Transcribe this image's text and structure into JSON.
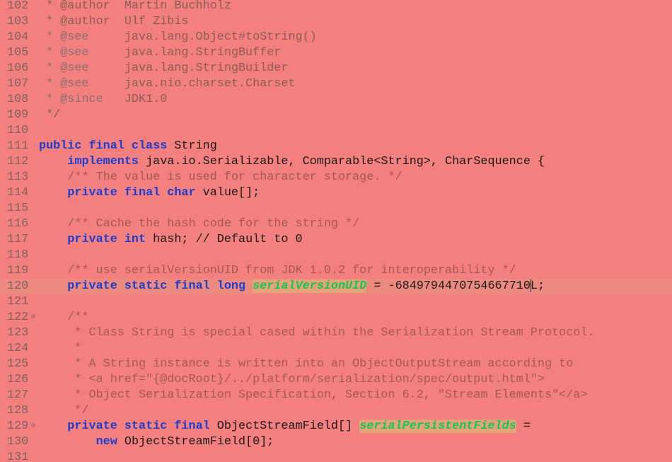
{
  "gutter": {
    "line_numbers": [
      "102",
      "103",
      "104",
      "105",
      "106",
      "107",
      "108",
      "109",
      "110",
      "111",
      "112",
      "113",
      "114",
      "115",
      "116",
      "117",
      "118",
      "119",
      "120",
      "121",
      "122",
      "123",
      "124",
      "125",
      "126",
      "127",
      "128",
      "129",
      "130",
      "131"
    ],
    "fold_marker": "⊖"
  },
  "code": {
    "l102": " * @author  Martin Buchholz",
    "l103": " * @author  Ulf Zibis",
    "l104_tag": " * @see",
    "l104_rest": "     java.lang.Object#toString()",
    "l105_tag": " * @see",
    "l105_rest": "     java.lang.StringBuffer",
    "l106_tag": " * @see",
    "l106_rest": "     java.lang.StringBuilder",
    "l107_tag": " * @see",
    "l107_rest": "     java.nio.charset.Charset",
    "l108_tag": " * @since",
    "l108_rest": "   JDK1.0",
    "l109": " */",
    "l111_kw": "public final class",
    "l111_rest": " String",
    "l112_indent": "    ",
    "l112_kw": "implements",
    "l112_rest": " java.io.Serializable, Comparable<String>, CharSequence {",
    "l113_indent": "    ",
    "l113": "/** The value is used for character storage. */",
    "l114_indent": "    ",
    "l114_kw": "private final char",
    "l114_rest": " value[];",
    "l116_indent": "    ",
    "l116": "/** Cache the hash code for the string */",
    "l117_indent": "    ",
    "l117_kw": "private int",
    "l117_rest": " hash; // Default to 0",
    "l119_indent": "    ",
    "l119": "/** use serialVersionUID from JDK 1.0.2 for interoperability */",
    "l120_indent": "    ",
    "l120_kw": "private static final long",
    "l120_sp": " ",
    "l120_field": "serialVersionUID",
    "l120_eq": " = -6849794470754667710",
    "l120_end": "L;",
    "l122": "    /**",
    "l123": "     * Class String is special cased within the Serialization Stream Protocol.",
    "l124": "     *",
    "l125": "     * A String instance is written into an ObjectOutputStream according to",
    "l126": "     * <a href=\"{@docRoot}/../platform/serialization/spec/output.html\">",
    "l127": "     * Object Serialization Specification, Section 6.2, \"Stream Elements\"</a>",
    "l128": "     */",
    "l129_indent": "    ",
    "l129_kw": "private static final",
    "l129_rest": " ObjectStreamField[] ",
    "l129_field": "serialPersistentFields",
    "l129_end": " =",
    "l130_indent": "        ",
    "l130_kw": "new",
    "l130_rest": " ObjectStreamField[0];"
  }
}
